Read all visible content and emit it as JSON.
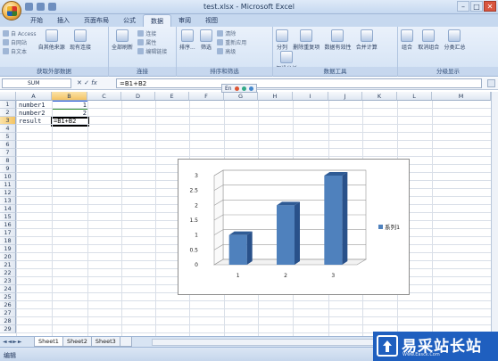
{
  "window": {
    "title": "test.xlsx - Microsoft Excel"
  },
  "tabs": [
    {
      "label": "开始"
    },
    {
      "label": "插入"
    },
    {
      "label": "页面布局"
    },
    {
      "label": "公式"
    },
    {
      "label": "数据"
    },
    {
      "label": "审阅"
    },
    {
      "label": "视图"
    }
  ],
  "active_tab": "数据",
  "ribbon_groups": [
    {
      "label": "获取外部数据",
      "items": [
        "自 Access",
        "自网站",
        "自文本",
        "自其他来源",
        "现有连接"
      ]
    },
    {
      "label": "连接",
      "items": [
        "全部刷新",
        "连接",
        "属性",
        "编辑链接"
      ]
    },
    {
      "label": "排序和筛选",
      "items": [
        "排序...",
        "筛选",
        "清除",
        "重新应用",
        "高级"
      ]
    },
    {
      "label": "数据工具",
      "items": [
        "分列",
        "删除重复项",
        "数据有效性",
        "合并计算",
        "假设分析"
      ]
    },
    {
      "label": "分级显示",
      "items": [
        "组合",
        "取消组合",
        "分类汇总"
      ]
    }
  ],
  "formula_bar": {
    "name_box": "SUM",
    "formula": "=B1+B2"
  },
  "columns": [
    "A",
    "B",
    "C",
    "D",
    "E",
    "F",
    "G",
    "H",
    "I",
    "J",
    "K",
    "L",
    "M"
  ],
  "rows": [
    "1",
    "2",
    "3",
    "4",
    "5",
    "6",
    "7",
    "8",
    "9",
    "10",
    "11",
    "12",
    "13",
    "14",
    "15",
    "16",
    "17",
    "18",
    "19",
    "20",
    "21",
    "22",
    "23",
    "24",
    "25",
    "26",
    "27",
    "28",
    "29"
  ],
  "cells": {
    "a1": "number1",
    "b1": "1",
    "a2": "number2",
    "b2": "2",
    "a3": "result",
    "b3": "=B1+B2"
  },
  "ime_toolbar": "En",
  "chart_data": {
    "type": "bar",
    "categories": [
      "1",
      "2",
      "3"
    ],
    "series": [
      {
        "name": "系列1",
        "values": [
          1,
          2,
          3
        ]
      }
    ],
    "ylim": [
      0,
      3
    ],
    "yticks": [
      "0",
      "0.5",
      "1",
      "1.5",
      "2",
      "2.5",
      "3"
    ],
    "legend": "right",
    "grid": true,
    "color": "#4f81bd"
  },
  "sheets": [
    "Sheet1",
    "Sheet2",
    "Sheet3"
  ],
  "active_sheet": "Sheet1",
  "status": "编辑",
  "watermark": {
    "title": "易采站长站",
    "subtitle": "Www.Easck.Com"
  }
}
